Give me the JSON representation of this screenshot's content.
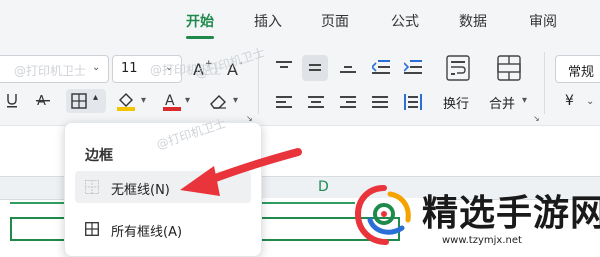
{
  "tabs": [
    {
      "label": "开始",
      "active": true
    },
    {
      "label": "插入"
    },
    {
      "label": "页面"
    },
    {
      "label": "公式"
    },
    {
      "label": "数据"
    },
    {
      "label": "审阅"
    }
  ],
  "font": {
    "size_value": "11"
  },
  "toolbar": {
    "wrap_label": "换行",
    "merge_label": "合并",
    "number_format": "常规",
    "currency_symbol": "¥"
  },
  "watermark": "@打印机卫士",
  "sheet": {
    "column_d": "D"
  },
  "border_menu": {
    "title": "边框",
    "items": [
      {
        "label": "无框线(N)",
        "highlighted": true
      },
      {
        "label": "所有框线(A)"
      }
    ]
  },
  "logo": {
    "name": "精选手游网",
    "url": "www.tzymjx.net"
  },
  "colors": {
    "accent": "#1f8a4c",
    "arrow": "#e8343a",
    "fill_color": "#f5c400",
    "font_color": "#d92b2b"
  }
}
